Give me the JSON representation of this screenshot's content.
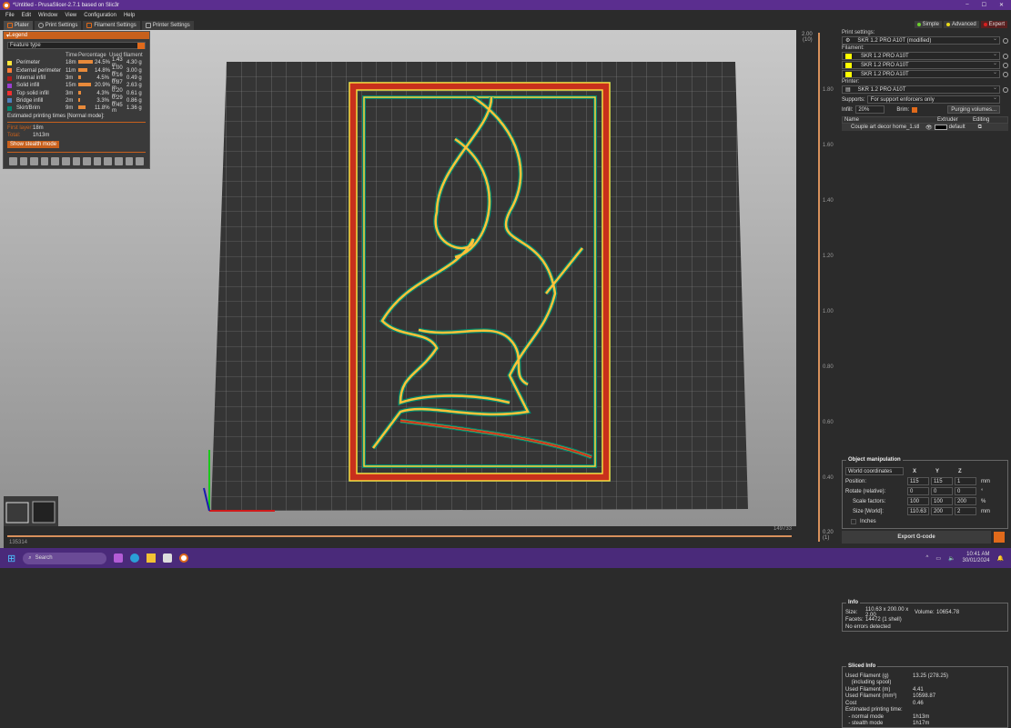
{
  "window": {
    "title": "*Untitled - PrusaSlicer-2.7.1 based on Slic3r",
    "controls": [
      "–",
      "☐",
      "✕"
    ]
  },
  "menu": [
    "File",
    "Edit",
    "Window",
    "View",
    "Configuration",
    "Help"
  ],
  "tabs": [
    "Plater",
    "Print Settings",
    "Filament Settings",
    "Printer Settings"
  ],
  "modes": [
    {
      "label": "Simple",
      "color": "#6ccf2e"
    },
    {
      "label": "Advanced",
      "color": "#e8d81a"
    },
    {
      "label": "Expert",
      "color": "#d81e1e"
    }
  ],
  "legend": {
    "title": "Legend",
    "view_type": "Feature type",
    "columns": [
      "Time",
      "Percentage",
      "Used filament"
    ],
    "rows": [
      {
        "name": "Perimeter",
        "color": "#ffe63a",
        "time": "18m",
        "pct": "24.5%",
        "frac": 1.0,
        "m": "1.43 m",
        "g": "4.30 g"
      },
      {
        "name": "External perimeter",
        "color": "#ff7d38",
        "time": "11m",
        "pct": "14.8%",
        "frac": 0.6,
        "m": "1.00 m",
        "g": "3.00 g"
      },
      {
        "name": "Internal infill",
        "color": "#b01c1c",
        "time": "3m",
        "pct": "4.5%",
        "frac": 0.18,
        "m": "0.16 m",
        "g": "0.49 g"
      },
      {
        "name": "Solid infill",
        "color": "#9a3fd0",
        "time": "15m",
        "pct": "20.9%",
        "frac": 0.85,
        "m": "0.87 m",
        "g": "2.63 g"
      },
      {
        "name": "Top solid infill",
        "color": "#f03030",
        "time": "3m",
        "pct": "4.3%",
        "frac": 0.18,
        "m": "0.20 m",
        "g": "0.61 g"
      },
      {
        "name": "Bridge infill",
        "color": "#4d80ba",
        "time": "2m",
        "pct": "3.3%",
        "frac": 0.14,
        "m": "0.29 m",
        "g": "0.86 g"
      },
      {
        "name": "Skirt/Brim",
        "color": "#00876e",
        "time": "9m",
        "pct": "11.8%",
        "frac": 0.48,
        "m": "0.45 m",
        "g": "1.36 g"
      }
    ],
    "estimated_label": "Estimated printing times [Normal mode]:",
    "first_layer_label": "First layer:",
    "first_layer": "18m",
    "total_label": "Total:",
    "total": "1h13m",
    "stealth_button": "Show stealth mode"
  },
  "vslider": {
    "top": "2.00",
    "top_layer": "(10)",
    "bottom": "0.20",
    "bottom_layer": "(1)",
    "ticks": [
      "2.00",
      "1.80",
      "1.60",
      "1.40",
      "1.20",
      "1.00",
      "0.80",
      "0.60",
      "0.40",
      "0.20"
    ]
  },
  "hslider": {
    "left": "135314",
    "right": "149733"
  },
  "right": {
    "print_label": "Print settings:",
    "print": "SKR 1.2 PRO A10T (modified)",
    "filament_label": "Filament:",
    "filaments": [
      "SKR 1.2 PRO A10T",
      "SKR 1.2 PRO A10T",
      "SKR 1.2 PRO A10T"
    ],
    "printer_label": "Printer:",
    "printer": "SKR 1.2 PRO A10T",
    "supports_label": "Supports:",
    "supports": "For support enforcers only",
    "infill_label": "Infill:",
    "infill": "20%",
    "brim_label": "Brim:",
    "purge_button": "Purging volumes...",
    "list_headers": [
      "Name",
      "Extruder",
      "Editing"
    ],
    "object": {
      "name": "Couple art decor home_1.stl",
      "extruder": "default"
    }
  },
  "manip": {
    "title": "Object manipulation",
    "coords": "World coordinates",
    "axes": [
      "X",
      "Y",
      "Z"
    ],
    "rows": [
      {
        "label": "Position:",
        "v": [
          "115",
          "115",
          "1"
        ],
        "unit": "mm"
      },
      {
        "label": "Rotate (relative):",
        "v": [
          "0",
          "0",
          "0"
        ],
        "unit": "°"
      },
      {
        "label": "Scale factors:",
        "v": [
          "100",
          "100",
          "200"
        ],
        "unit": "%"
      },
      {
        "label": "Size [World]:",
        "v": [
          "110.63",
          "200",
          "2"
        ],
        "unit": "mm"
      }
    ],
    "inches": "Inches"
  },
  "info": {
    "title": "Info",
    "size_label": "Size:",
    "size": "110.63 x 200.00 x 2.00",
    "volume_label": "Volume:",
    "volume": "10654.78",
    "facets_label": "Facets:",
    "facets": "14472 (1 shell)",
    "errors": "No errors detected"
  },
  "sliced": {
    "title": "Sliced Info",
    "rows": [
      {
        "l": "Used Filament (g)",
        "v": "13.25 (278.25)"
      },
      {
        "l": "    (including spool)",
        "v": ""
      },
      {
        "l": "Used Filament (m)",
        "v": "4.41"
      },
      {
        "l": "Used Filament (mm³)",
        "v": "10598.87"
      },
      {
        "l": "Cost",
        "v": "0.46"
      },
      {
        "l": "Estimated printing time:",
        "v": ""
      },
      {
        "l": "  - normal mode",
        "v": "1h13m"
      },
      {
        "l": "  - stealth mode",
        "v": "1h17m"
      }
    ]
  },
  "export_button": "Export G-code",
  "taskbar": {
    "search": "Search",
    "time": "10:41 AM",
    "date": "30/01/2024"
  }
}
